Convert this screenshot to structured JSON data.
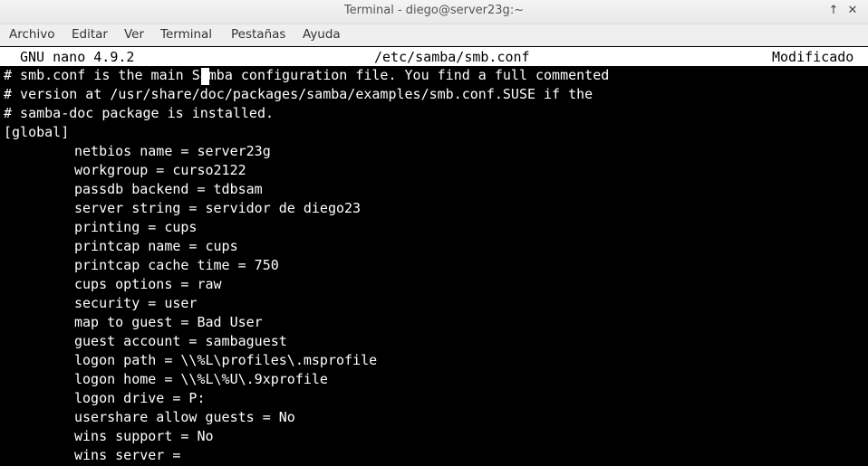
{
  "window": {
    "title": "Terminal - diego@server23g:~",
    "pin_glyph": "↑",
    "close_glyph": "✕"
  },
  "menu": [
    "Archivo",
    "Editar",
    "Ver",
    "Terminal",
    "Pestañas",
    "Ayuda"
  ],
  "nano": {
    "version": "GNU nano 4.9.2",
    "filename": "/etc/samba/smb.conf",
    "status": "Modificado"
  },
  "file_lines": [
    "# smb.conf is the main Samba configuration file. You find a full commented",
    "# version at /usr/share/doc/packages/samba/examples/smb.conf.SUSE if the",
    "# samba-doc package is installed.",
    "[global]",
    "netbios name = server23g",
    "workgroup = curso2122",
    "passdb backend = tdbsam",
    "server string = servidor de diego23",
    "printing = cups",
    "printcap name = cups",
    "printcap cache time = 750",
    "cups options = raw",
    "security = user",
    "map to guest = Bad User",
    "guest account = sambaguest",
    "logon path = \\\\%L\\profiles\\.msprofile",
    "logon home = \\\\%L\\%U\\.9xprofile",
    "logon drive = P:",
    "usershare allow guests = No",
    "wins support = No",
    "wins server ="
  ],
  "colors": {
    "terminal_bg": "#000000",
    "terminal_fg": "#ffffff",
    "header_bg": "#ffffff",
    "header_fg": "#000000"
  }
}
